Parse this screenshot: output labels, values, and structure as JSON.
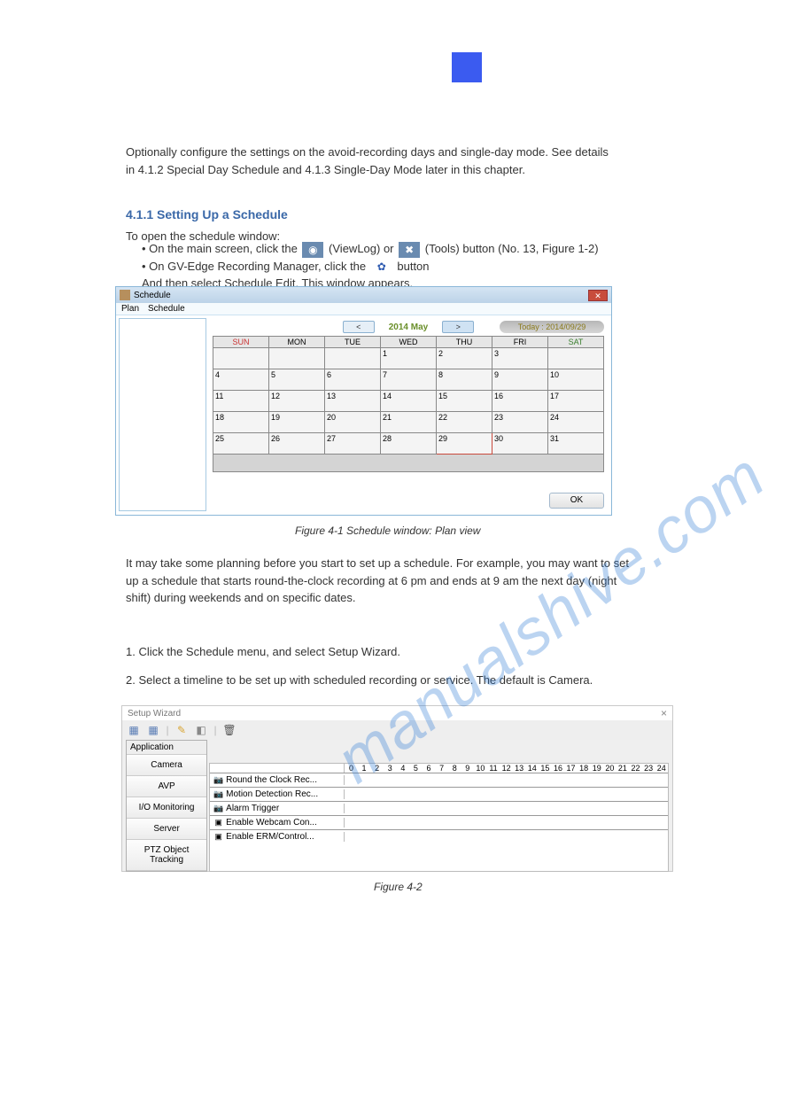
{
  "page_icon": "■",
  "intro_line1": "Optionally configure the settings on the avoid-recording days and single-day mode. See details",
  "intro_line2": "in 4.1.2 Special Day Schedule and 4.1.3 Single-Day Mode later in this chapter.",
  "section_title": "4.1.1 Setting Up a Schedule",
  "setup_intro": "To open the schedule window:",
  "bullet_eye_prefix": " On the main screen, click the ",
  "bullet_eye_suffix": " (ViewLog) or ",
  "bullet_tools": " (Tools) button (No. 13, Figure 1-2)",
  "bullet_gvedge": "On GV-Edge Recording Manager, click the ",
  "bullet_gvedge_after": " button",
  "bullet_after": "And then select Schedule Edit. This window appears.",
  "figure1": "Figure 4-1  Schedule window: Plan view",
  "body1": "It may take some planning before you start to set up a schedule. For example, you may want to set",
  "body2": "up a schedule that starts round-the-clock recording at 6 pm and ends at 9 am the next day (night",
  "body3": "shift) during weekends and on specific dates.",
  "step1": "1. Click the Schedule menu, and select Setup Wizard.",
  "step2": "2. Select a timeline to be set up with scheduled recording or service. The default is Camera.",
  "figure2": "Figure 4-2",
  "schedule": {
    "title": "Schedule",
    "menu1": "Plan",
    "menu2": "Schedule",
    "month": "2014 May",
    "today": "Today : 2014/09/29",
    "ok": "OK",
    "days": [
      "SUN",
      "MON",
      "TUE",
      "WED",
      "THU",
      "FRI",
      "SAT"
    ],
    "rows": [
      [
        "",
        "",
        "",
        "1",
        "2",
        "3",
        ""
      ],
      [
        "4",
        "5",
        "6",
        "7",
        "8",
        "9",
        "10"
      ],
      [
        "11",
        "12",
        "13",
        "14",
        "15",
        "16",
        "17"
      ],
      [
        "18",
        "19",
        "20",
        "21",
        "22",
        "23",
        "24"
      ],
      [
        "25",
        "26",
        "27",
        "28",
        "29",
        "30",
        "31"
      ]
    ],
    "today_cell": "29"
  },
  "wizard": {
    "title": "Setup Wizard",
    "apps_label": "Application",
    "tabs": [
      "Camera",
      "AVP",
      "I/O Monitoring",
      "Server",
      "PTZ Object Tracking"
    ],
    "hours": [
      "0",
      "1",
      "2",
      "3",
      "4",
      "5",
      "6",
      "7",
      "8",
      "9",
      "10",
      "11",
      "12",
      "13",
      "14",
      "15",
      "16",
      "17",
      "18",
      "19",
      "20",
      "21",
      "22",
      "23",
      "24"
    ],
    "rows": [
      "Round the Clock Rec...",
      "Motion Detection Rec...",
      "Alarm Trigger",
      "Enable Webcam Con...",
      "Enable ERM/Control..."
    ]
  }
}
